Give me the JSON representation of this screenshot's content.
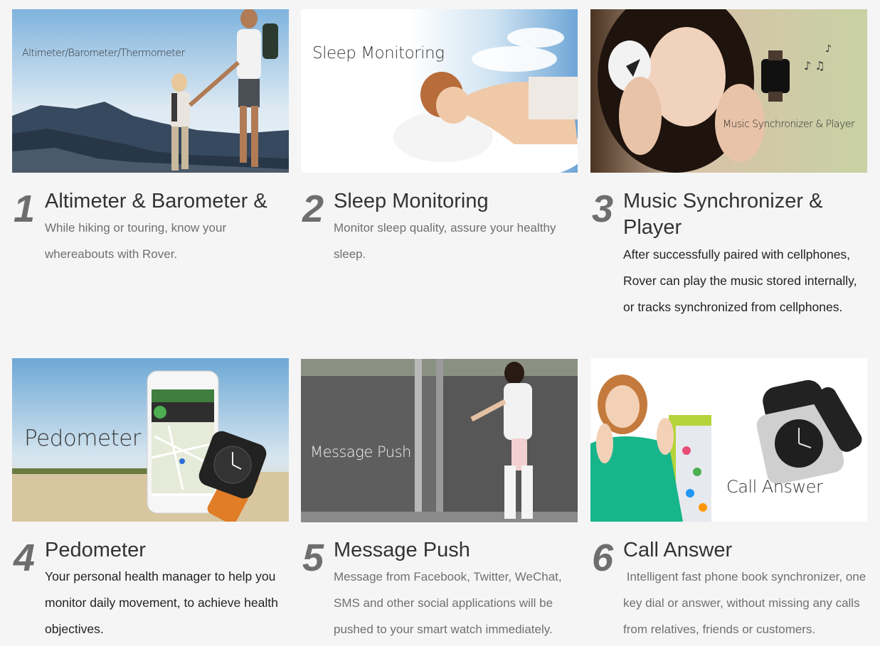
{
  "features": [
    {
      "number": "1",
      "image_caption": "Altimeter/Barometer/Thermometer",
      "title": "Altimeter & Barometer &",
      "description": "While hiking or touring, know your whereabouts with Rover."
    },
    {
      "number": "2",
      "image_caption": "Sleep Monitoring",
      "title": "Sleep Monitoring",
      "description": "Monitor sleep quality, assure your healthy sleep."
    },
    {
      "number": "3",
      "image_caption": "Music Synchronizer & Player",
      "title": "Music Synchronizer & Player",
      "description": "After successfully paired with cellphones, Rover can play the music stored internally, or tracks synchronized from cellphones."
    },
    {
      "number": "4",
      "image_caption": "Pedometer",
      "title": "Pedometer",
      "description": "Your personal health manager to help you monitor daily movement, to achieve health objectives."
    },
    {
      "number": "5",
      "image_caption": "Message Push",
      "title": "Message Push",
      "description": "Message from Facebook, Twitter, WeChat, SMS and other social applications will be pushed to your smart watch immediately."
    },
    {
      "number": "6",
      "image_caption": "Call Answer",
      "title": "Call Answer",
      "description": " Intelligent fast phone book synchronizer, one key dial or answer, without missing any calls from relatives, friends or customers."
    }
  ]
}
